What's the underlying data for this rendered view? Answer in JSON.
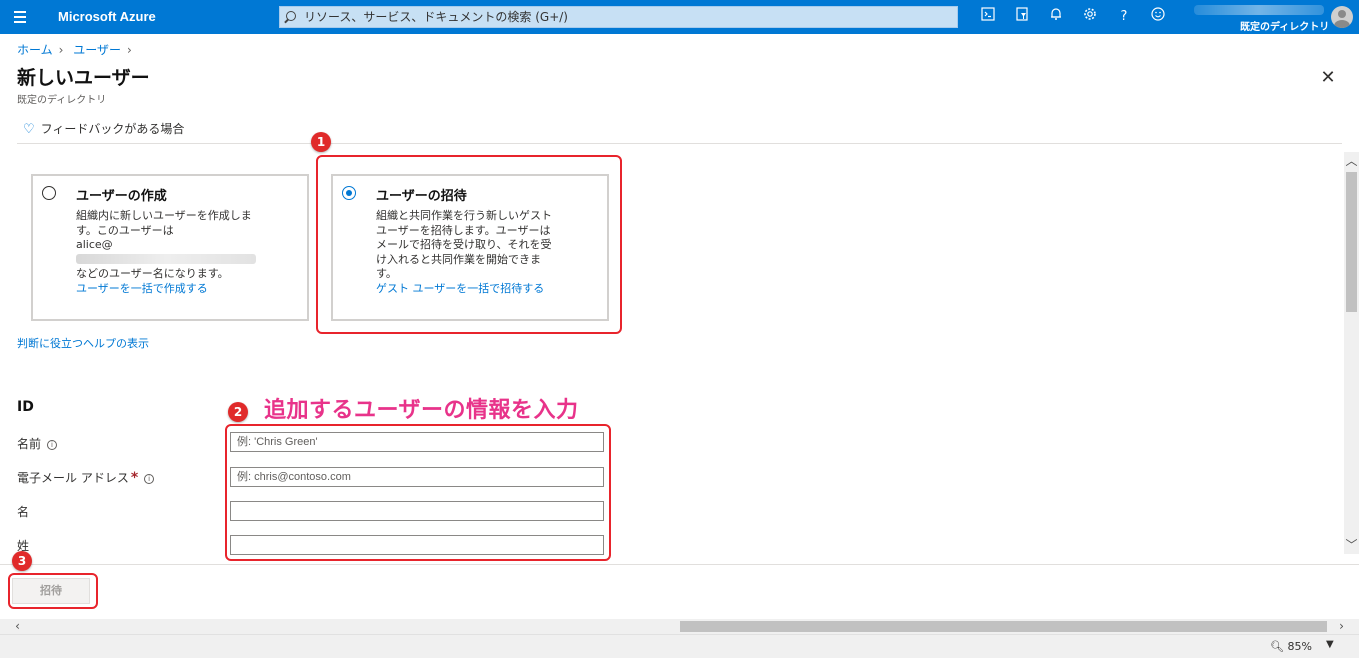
{
  "topbar": {
    "brand": "Microsoft Azure",
    "search_placeholder": "リソース、サービス、ドキュメントの検索 (G+/)",
    "directory": "既定のディレクトリ",
    "icons": [
      "cloud-shell-icon",
      "directory-filter-icon",
      "notifications-icon",
      "settings-icon",
      "help-icon",
      "feedback-smiley-icon"
    ]
  },
  "breadcrumb": [
    "ホーム",
    "ユーザー"
  ],
  "page": {
    "title": "新しいユーザー",
    "subtitle": "既定のディレクトリ",
    "feedback": "フィードバックがある場合"
  },
  "options": {
    "create": {
      "title": "ユーザーの作成",
      "line1": "組織内に新しいユーザーを作成しま",
      "line2": "す。このユーザーは",
      "line3_prefix": "alice@",
      "line4": "などのユーザー名になります。",
      "link": "ユーザーを一括で作成する",
      "selected": false
    },
    "invite": {
      "title": "ユーザーの招待",
      "line1": "組織と共同作業を行う新しいゲスト",
      "line2": "ユーザーを招待します。ユーザーは",
      "line3": "メールで招待を受け取り、それを受",
      "line4": "け入れると共同作業を開始できま",
      "line5": "す。",
      "link": "ゲスト ユーザーを一括で招待する",
      "selected": true
    }
  },
  "help_link": "判断に役立つヘルプの表示",
  "annotation": {
    "badge1": "1",
    "badge2": "2",
    "badge3": "3",
    "callout": "追加するユーザーの情報を入力"
  },
  "form": {
    "section": "ID",
    "name_label": "名前",
    "name_placeholder": "例: 'Chris Green'",
    "email_label": "電子メール アドレス",
    "email_placeholder": "例: chris@contoso.com",
    "first_label": "名",
    "last_label": "姓"
  },
  "footer": {
    "invite_button": "招待"
  },
  "status": {
    "zoom": "85%"
  },
  "colors": {
    "accent": "#0078d4",
    "highlight": "#e8242c",
    "callout": "#e8338a"
  }
}
